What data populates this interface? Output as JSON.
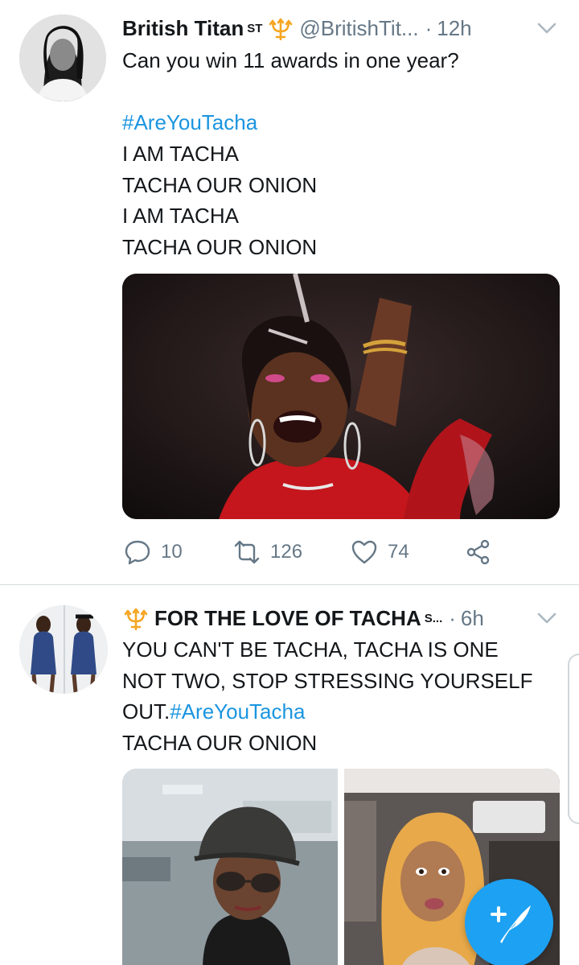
{
  "tweets": [
    {
      "author": {
        "name": "British Titan",
        "name_suffix": "ST",
        "handle": "@BritishTit...",
        "avatar_icon": "profile-photo"
      },
      "time": "12h",
      "dot": "·",
      "lines": [
        "Can you win 11 awards in one year?",
        "",
        "#AreYouTacha",
        "I AM TACHA",
        "TACHA OUR ONION",
        "I AM TACHA",
        "TACHA OUR ONION"
      ],
      "actions": {
        "replies": "10",
        "retweets": "126",
        "likes": "74"
      }
    },
    {
      "author": {
        "name": "FOR THE LOVE OF TACHA",
        "name_suffix": "S...",
        "avatar_icon": "profile-photo"
      },
      "time": "6h",
      "dot": "·",
      "lines": [
        "YOU CAN'T BE TACHA,  TACHA IS ONE",
        "NOT TWO,  STOP STRESSING YOURSELF",
        "OUT.",
        "TACHA OUR ONION"
      ],
      "hashtag_inline": "#AreYouTacha"
    }
  ],
  "icons": {
    "reply": "reply-icon",
    "retweet": "retweet-icon",
    "like": "heart-icon",
    "share": "share-icon",
    "compose": "compose-tweet-icon",
    "caret": "chevron-down-icon",
    "trident": "trident-emoji-icon"
  },
  "colors": {
    "accent": "#1da1f2",
    "hashtag": "#1b95e0",
    "muted": "#657786",
    "text": "#14171a"
  }
}
